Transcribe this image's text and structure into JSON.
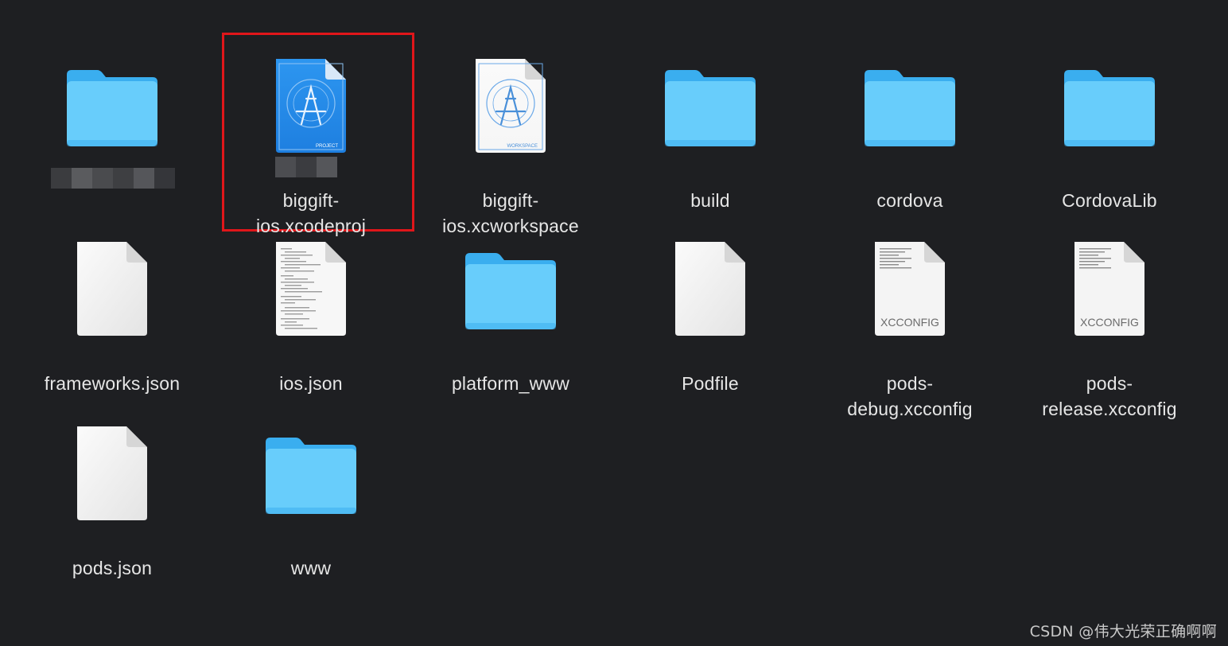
{
  "items": [
    {
      "id": "redacted-folder",
      "type": "folder",
      "label_lines": []
    },
    {
      "id": "xcodeproj",
      "type": "xcodeproj",
      "label_lines": [
        "biggift-",
        "ios.xcodeproj"
      ],
      "icon_badge": "PROJECT",
      "selected": true
    },
    {
      "id": "xcworkspace",
      "type": "xcworkspace",
      "label_lines": [
        "biggift-",
        "ios.xcworkspace"
      ],
      "icon_badge": "WORKSPACE"
    },
    {
      "id": "build",
      "type": "folder",
      "label_lines": [
        "build"
      ]
    },
    {
      "id": "cordova",
      "type": "folder",
      "label_lines": [
        "cordova"
      ]
    },
    {
      "id": "cordovalib",
      "type": "folder",
      "label_lines": [
        "CordovaLib"
      ]
    },
    {
      "id": "frameworks-json",
      "type": "document",
      "label_lines": [
        "frameworks.json"
      ]
    },
    {
      "id": "ios-json",
      "type": "text-document",
      "label_lines": [
        "ios.json"
      ]
    },
    {
      "id": "platform-www",
      "type": "folder",
      "label_lines": [
        "platform_www"
      ]
    },
    {
      "id": "podfile",
      "type": "document",
      "label_lines": [
        "Podfile"
      ]
    },
    {
      "id": "pods-debug",
      "type": "xcconfig",
      "label_lines": [
        "pods-",
        "debug.xcconfig"
      ],
      "icon_badge": "XCCONFIG"
    },
    {
      "id": "pods-release",
      "type": "xcconfig",
      "label_lines": [
        "pods-",
        "release.xcconfig"
      ],
      "icon_badge": "XCCONFIG"
    },
    {
      "id": "pods-json",
      "type": "document",
      "label_lines": [
        "pods.json"
      ]
    },
    {
      "id": "www",
      "type": "folder",
      "label_lines": [
        "www"
      ]
    }
  ],
  "watermark": "CSDN @伟大光荣正确啊啊",
  "colors": {
    "background": "#1e1f22",
    "folder_light": "#68cdfb",
    "folder_dark": "#3aaeef",
    "selection_border": "#e0161a",
    "label_text": "#e6e6e6"
  }
}
